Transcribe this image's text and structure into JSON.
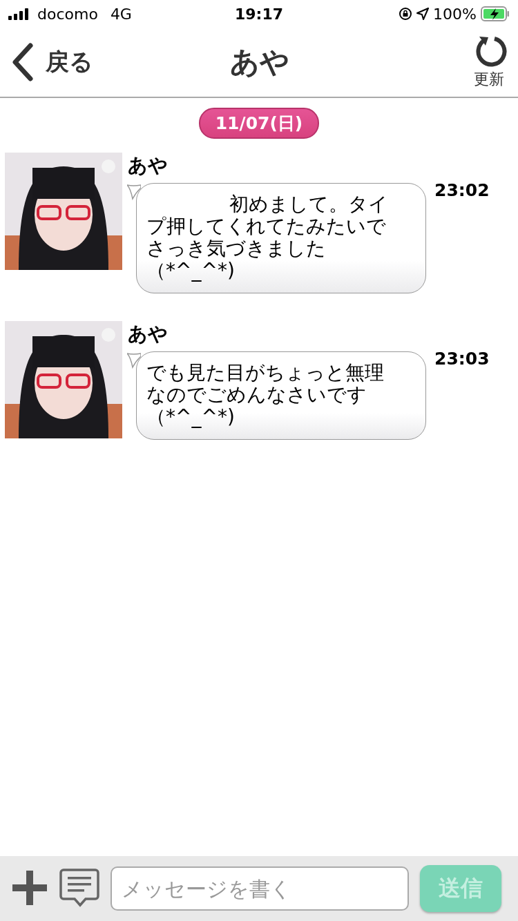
{
  "status_bar": {
    "carrier": "docomo",
    "network": "4G",
    "time": "19:17",
    "battery": "100%"
  },
  "header": {
    "back": "戻る",
    "title": "あや",
    "refresh": "更新"
  },
  "date": "11/07(日)",
  "messages": [
    {
      "sender": "あや",
      "first_line_indent": true,
      "lines": [
        "初めまして。タイ",
        "プ押してくれてたみたいで",
        "さっき気づきました",
        "（*^_^*)"
      ],
      "time": "23:02"
    },
    {
      "sender": "あや",
      "first_line_indent": false,
      "lines": [
        "でも見た目がちょっと無理",
        "なのでごめんなさいです",
        "（*^_^*)"
      ],
      "time": "23:03"
    }
  ],
  "composer": {
    "placeholder": "メッセージを書く",
    "send": "送信",
    "send_disabled": true
  }
}
